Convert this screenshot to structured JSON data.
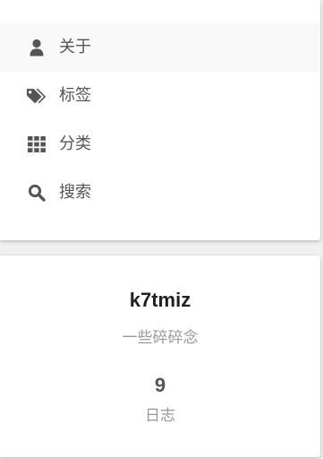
{
  "menu": {
    "items": [
      {
        "label": "关于",
        "icon": "user-icon",
        "active": true
      },
      {
        "label": "标签",
        "icon": "tags-icon",
        "active": false
      },
      {
        "label": "分类",
        "icon": "grid-icon",
        "active": false
      },
      {
        "label": "搜索",
        "icon": "search-icon",
        "active": false
      }
    ]
  },
  "profile": {
    "name": "k7tmiz",
    "description": "一些碎碎念",
    "stats": [
      {
        "count": "9",
        "label": "日志"
      }
    ]
  },
  "colors": {
    "text": "#555555",
    "muted": "#999999",
    "title": "#222222",
    "active_bg": "#f9f9f9",
    "background": "#f0f0f0"
  }
}
